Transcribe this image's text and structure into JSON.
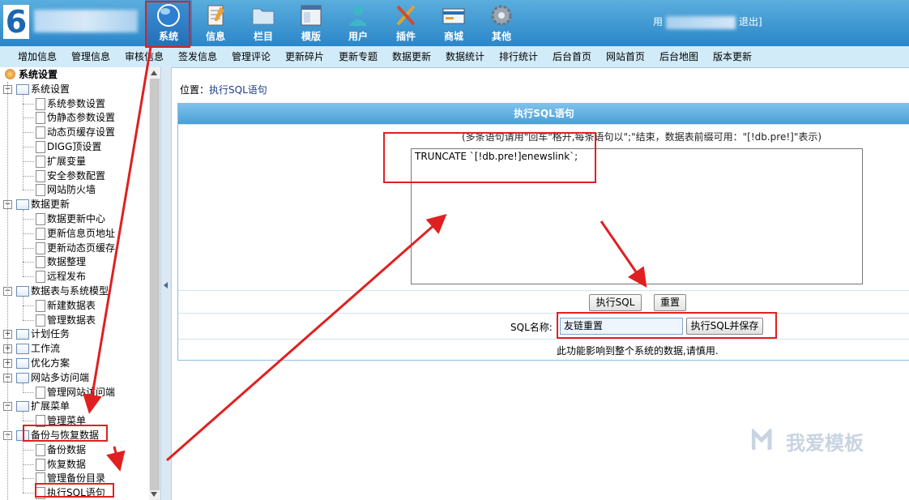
{
  "topbar": {
    "logo_text": "6",
    "nav": [
      {
        "label": "系统",
        "icon": "globe-icon",
        "active": true
      },
      {
        "label": "信息",
        "icon": "notepad-icon",
        "active": false
      },
      {
        "label": "栏目",
        "icon": "folder-icon",
        "active": false
      },
      {
        "label": "模版",
        "icon": "window-icon",
        "active": false
      },
      {
        "label": "用户",
        "icon": "user-icon",
        "active": false
      },
      {
        "label": "插件",
        "icon": "tools-icon",
        "active": false
      },
      {
        "label": "商城",
        "icon": "shop-card-icon",
        "active": false
      },
      {
        "label": "其他",
        "icon": "gear-icon",
        "active": false
      }
    ],
    "user_prefix": "用",
    "logout": "退出]"
  },
  "submenu": [
    "增加信息",
    "管理信息",
    "审核信息",
    "签发信息",
    "管理评论",
    "更新碎片",
    "更新专题",
    "数据更新",
    "数据统计",
    "排行统计",
    "后台首页",
    "网站首页",
    "后台地图",
    "版本更新"
  ],
  "tree": {
    "root": "系统设置",
    "groups": [
      {
        "label": "系统设置",
        "expanded": true,
        "items": [
          "系统参数设置",
          "伪静态参数设置",
          "动态页缓存设置",
          "DIGG顶设置",
          "扩展变量",
          "安全参数配置",
          "网站防火墙"
        ]
      },
      {
        "label": "数据更新",
        "expanded": true,
        "items": [
          "数据更新中心",
          "更新信息页地址",
          "更新动态页缓存",
          "数据整理",
          "远程发布"
        ]
      },
      {
        "label": "数据表与系统模型",
        "expanded": true,
        "items": [
          "新建数据表",
          "管理数据表"
        ]
      },
      {
        "label": "计划任务",
        "expanded": false,
        "items": []
      },
      {
        "label": "工作流",
        "expanded": false,
        "items": []
      },
      {
        "label": "优化方案",
        "expanded": false,
        "items": []
      },
      {
        "label": "网站多访问端",
        "expanded": true,
        "items": [
          "管理网站访问端"
        ]
      },
      {
        "label": "扩展菜单",
        "expanded": true,
        "items": [
          "管理菜单"
        ]
      },
      {
        "label": "备份与恢复数据",
        "expanded": true,
        "items": [
          "备份数据",
          "恢复数据",
          "管理备份目录",
          "执行SQL语句"
        ]
      }
    ]
  },
  "location": {
    "label": "位置：",
    "current": "执行SQL语句"
  },
  "panel": {
    "title": "执行SQL语句",
    "hint": "(多条语句请用\"回车\"格开,每条语句以\";\"结束，数据表前缀可用：\"[!db.pre!]\"表示)",
    "sql_value": "TRUNCATE `[!db.pre!]enewslink`;",
    "execute_button": "执行SQL",
    "reset_button": "重置",
    "name_label": "SQL名称:",
    "name_value": "友链重置",
    "execute_save_button": "执行SQL并保存",
    "warning": "此功能影响到整个系统的数据,请慎用."
  },
  "watermark": "我爱模板",
  "colors": {
    "annotation": "#e02020",
    "topbar": "#3a95d4",
    "panel_header": "#5aaee0"
  }
}
